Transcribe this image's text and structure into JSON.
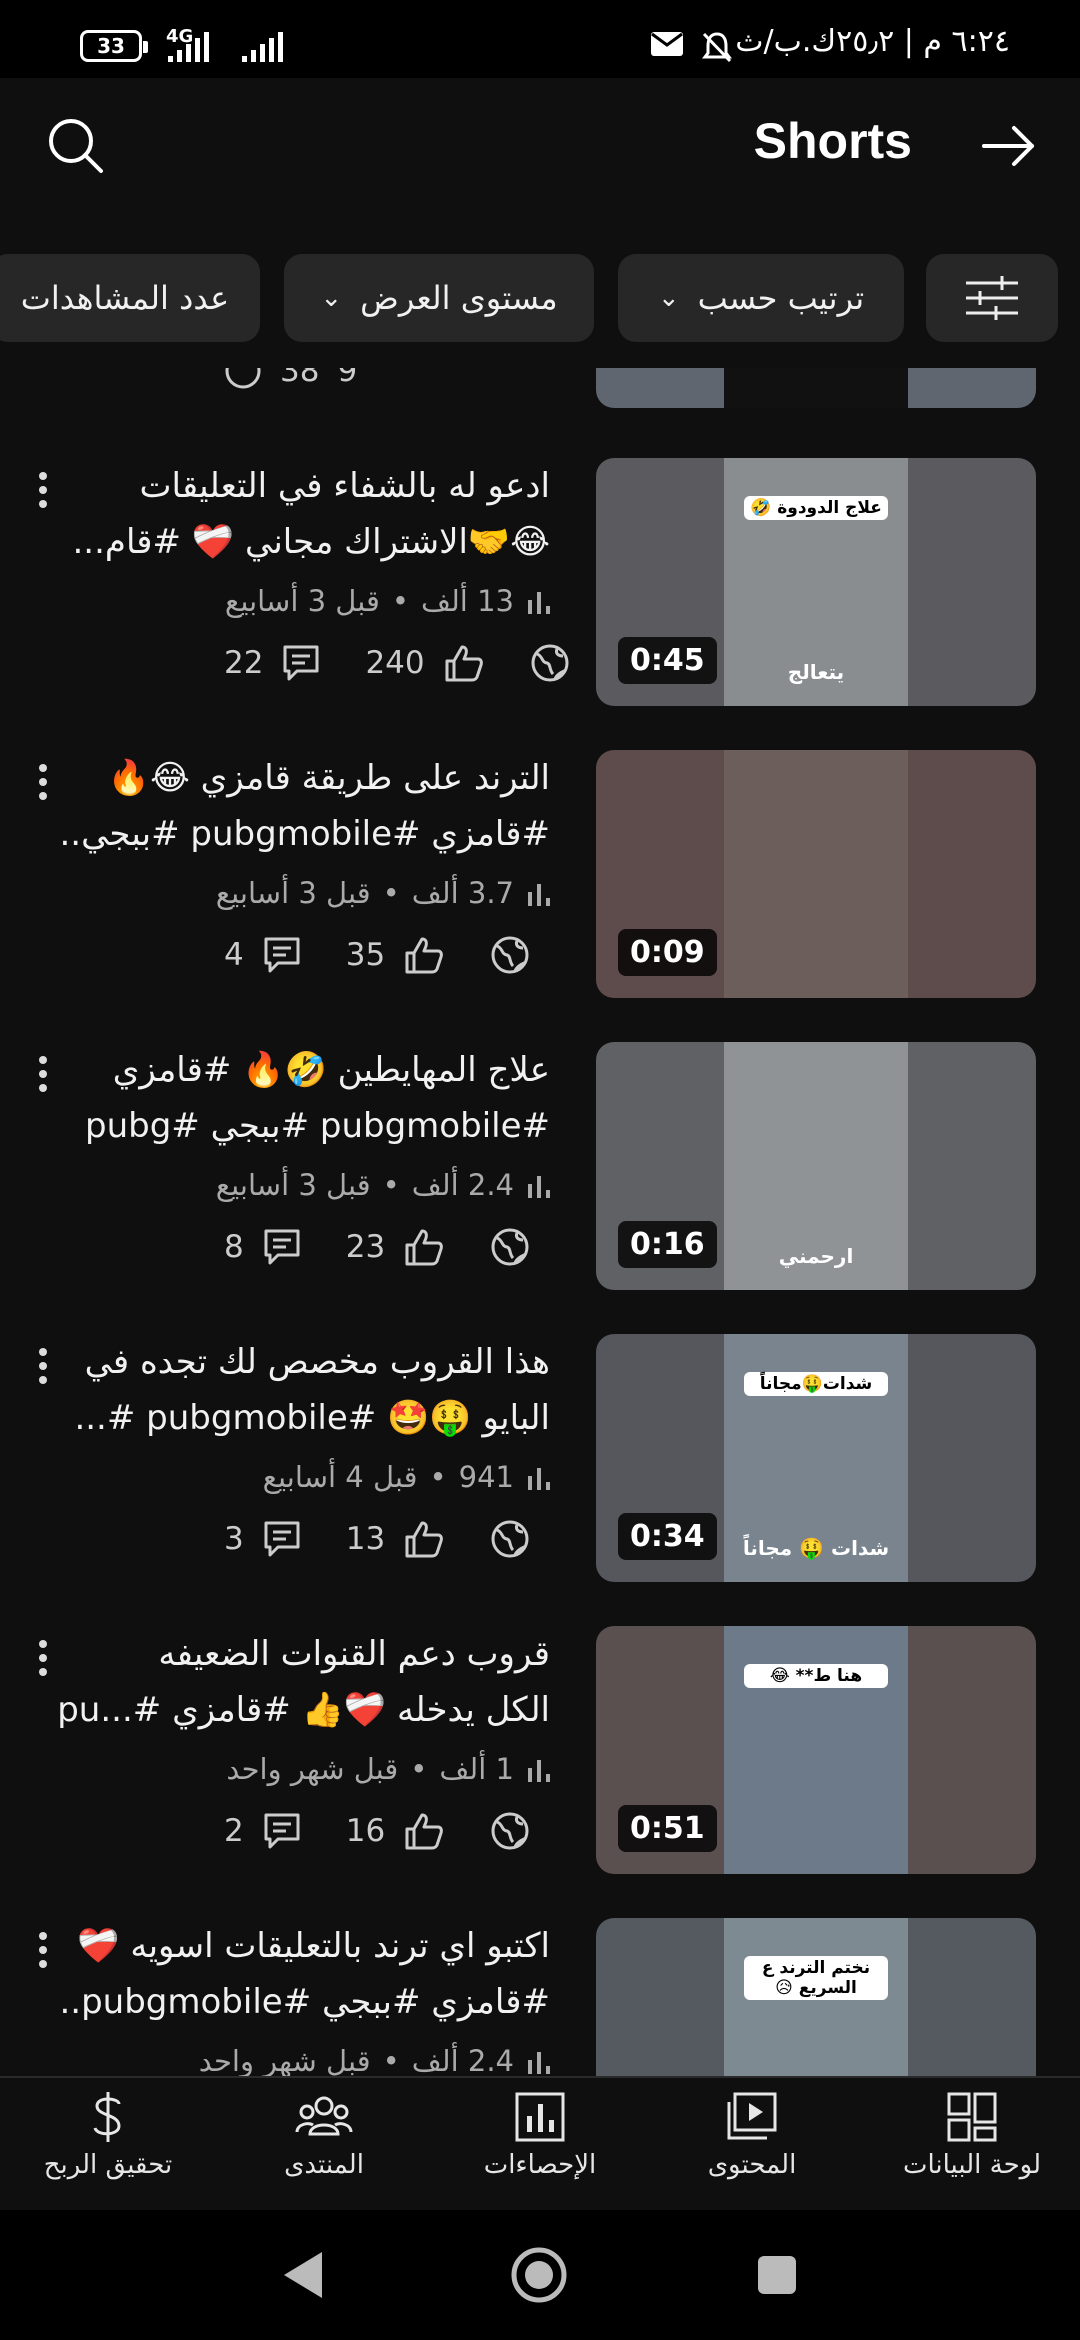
{
  "status_bar": {
    "battery": "33",
    "network": "4G",
    "time_text": "٦:٢٤ م | ٢٥٫٢ك.ب/ث"
  },
  "header": {
    "title": "Shorts"
  },
  "filters": {
    "chips": [
      {
        "label": "ترتيب حسب"
      },
      {
        "label": "مستوى العرض"
      },
      {
        "label": "عدد المشاهدات"
      }
    ]
  },
  "partial_row": {
    "likes": "38",
    "comments": "9"
  },
  "videos": [
    {
      "title_line1": "ادعو له بالشفاء في التعليقات",
      "title_line2": "😂🤝الاشتراك مجاني ❤️‍🩹 #قام...",
      "views": "13 ألف",
      "age": "قبل 3 أسابيع",
      "likes": "240",
      "comments": "22",
      "duration": "0:45",
      "thumb_caption": "علاج الدودوة 🤣",
      "thumb_bottom": "يتعالج",
      "colors": {
        "side": "#5a5a5f",
        "center": "#8a8d90"
      }
    },
    {
      "title_line1": "الترند على طريقة قامزي 😂🔥",
      "title_line2": "#قامزي #pubgmobile #ببجي...",
      "views": "3.7 ألف",
      "age": "قبل 3 أسابيع",
      "likes": "35",
      "comments": "4",
      "duration": "0:09",
      "thumb_caption": "",
      "thumb_bottom": "",
      "colors": {
        "side": "#5e4c4c",
        "center": "#6c5e5a"
      }
    },
    {
      "title_line1": "علاج المهايطين 🤣🔥 #قامزي",
      "title_line2": "#pubgmobile #ببجي #pubg",
      "views": "2.4 ألف",
      "age": "قبل 3 أسابيع",
      "likes": "23",
      "comments": "8",
      "duration": "0:16",
      "thumb_caption": "",
      "thumb_bottom": "ارحمني",
      "colors": {
        "side": "#5f6164",
        "center": "#8f9396"
      }
    },
    {
      "title_line1": "هذا القروب مخصص لك تجده في",
      "title_line2": "البايو 🤑🤩 #pubgmobile #...",
      "views": "941",
      "age": "قبل 4 أسابيع",
      "likes": "13",
      "comments": "3",
      "duration": "0:34",
      "thumb_caption": "شدات🤑مجاناً",
      "thumb_bottom": "شدات 🤑 مجاناً",
      "colors": {
        "side": "#56575c",
        "center": "#7a848e"
      }
    },
    {
      "title_line1": "قروب دعم القنوات الضعيفه",
      "title_line2": "الكل يدخله ❤️‍🩹👍 #قامزي #...pu",
      "views": "1 ألف",
      "age": "قبل شهر واحد",
      "likes": "16",
      "comments": "2",
      "duration": "0:51",
      "thumb_caption": "هنا ط** 😂",
      "thumb_bottom": "",
      "colors": {
        "side": "#5b5050",
        "center": "#6d7a8a"
      }
    },
    {
      "title_line1": "اكتبو اي ترند بالتعليقات اسويه ❤️‍🩹",
      "title_line2": "#قامزي #ببجي #pubgmobile...",
      "views": "2.4 ألف",
      "age": "قبل شهر واحد",
      "likes": "",
      "comments": "",
      "duration": "",
      "thumb_caption": "نختم الترند ع السريع 😥",
      "thumb_bottom": "",
      "colors": {
        "side": "#555a60",
        "center": "#7e8a92"
      }
    }
  ],
  "bottom_nav": {
    "items": [
      {
        "label": "لوحة البيانات",
        "icon": "dashboard-icon"
      },
      {
        "label": "المحتوى",
        "icon": "content-icon"
      },
      {
        "label": "الإحصاءات",
        "icon": "analytics-icon"
      },
      {
        "label": "المنتدى",
        "icon": "community-icon"
      },
      {
        "label": "تحقيق الربح",
        "icon": "earn-icon"
      }
    ]
  }
}
